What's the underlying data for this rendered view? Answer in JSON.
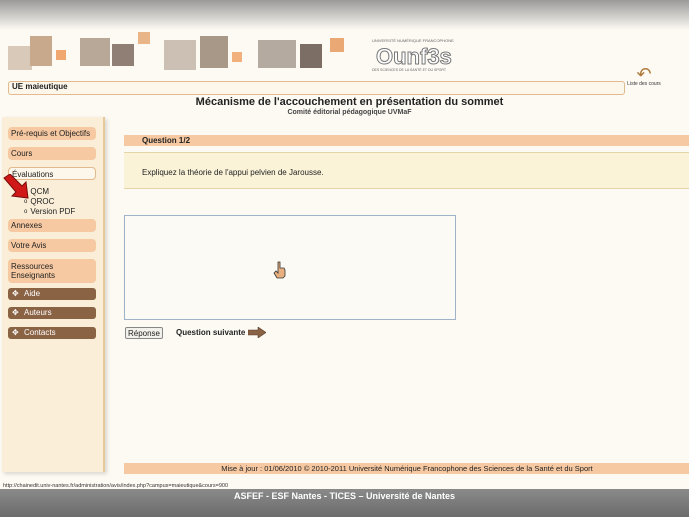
{
  "header": {
    "logo_small": "UNIVERSITÉ NUMÉRIQUE FRANCOPHONE",
    "logo_big": "Ounf3s",
    "logo_sub": "DES SCIENCES DE LA SANTÉ ET DU SPORT",
    "course_label": "UE maieutique",
    "liste_cours": "Liste des cours"
  },
  "title": {
    "main": "Mécanisme de l'accouchement en présentation du sommet",
    "sub": "Comité éditorial pédagogique UVMaF"
  },
  "sidebar": {
    "items": [
      {
        "label": "Pré-requis et Objectifs"
      },
      {
        "label": "Cours"
      },
      {
        "label": "Évaluations"
      }
    ],
    "sub_items": [
      "QCM",
      "QROC",
      "Version PDF"
    ],
    "items2": [
      {
        "label": "Annexes"
      },
      {
        "label": "Votre Avis"
      },
      {
        "label": "Ressources Enseignants"
      }
    ],
    "brown_items": [
      {
        "label": "Aide"
      },
      {
        "label": "Auteurs"
      },
      {
        "label": "Contacts"
      }
    ]
  },
  "main": {
    "question_header": "Question 1/2",
    "question_text": "Expliquez la théorie de l'appui pelvien de Jarousse.",
    "answer_button": "Réponse",
    "next_label": "Question suivante"
  },
  "footer": {
    "text": "Mise à jour : 01/06/2010 © 2010-2011 Université Numérique Francophone des Sciences de la Santé et du Sport"
  },
  "status_url": "http://chainedit.univ-nantes.fr/administration/avis/index.php?campus=maieutique&cours=900",
  "caption": "ASFEF - ESF Nantes - TICES – Université de Nantes",
  "colors": {
    "accent": "#f6c9a2",
    "brown": "#8a6244",
    "question_bg": "#fbf3d8",
    "red_arrow": "#d01818"
  }
}
